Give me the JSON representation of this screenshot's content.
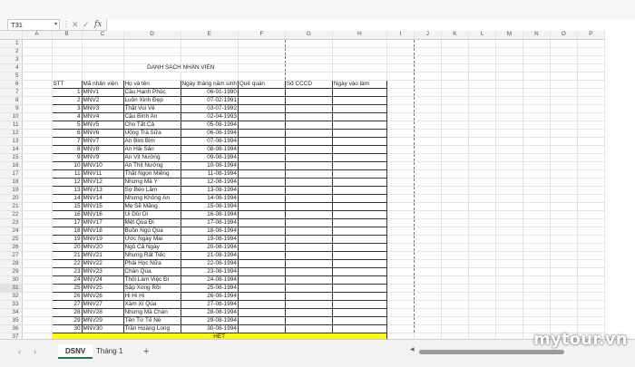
{
  "formula_bar": {
    "name_box": "T31",
    "icons": [
      "more-options-icon",
      "cancel-icon",
      "enter-icon",
      "function-icon"
    ],
    "fx_label": "fx",
    "formula": ""
  },
  "columns": [
    "A",
    "B",
    "C",
    "D",
    "E",
    "F",
    "G",
    "H",
    "I",
    "J",
    "K",
    "L",
    "M",
    "N",
    "O",
    "P"
  ],
  "selected_row": 31,
  "sheet": {
    "title": "DANH SÁCH NHÂN VIÊN",
    "headers": [
      "STT",
      "Mã nhân viên",
      "Họ và tên",
      "Ngày tháng năm sinh",
      "Quê quán",
      "Số CCCD",
      "Ngày vào làm"
    ],
    "rows": [
      [
        "1",
        "MNV1",
        "Cầu Hạnh Phúc",
        "06-01-1990"
      ],
      [
        "2",
        "MNV2",
        "Luôn Xinh Đẹp",
        "07-02-1991"
      ],
      [
        "3",
        "MNV3",
        "Thật Vui Vẻ",
        "03-07-1992"
      ],
      [
        "4",
        "MNV4",
        "Cầu Bình An",
        "02-04-1993"
      ],
      [
        "5",
        "MNV5",
        "Cho Tất Cả",
        "05-08-1994"
      ],
      [
        "6",
        "MNV6",
        "Uống Trà Sữa",
        "06-08-1994"
      ],
      [
        "7",
        "MNV7",
        "Ăn Bim Bim",
        "07-08-1994"
      ],
      [
        "8",
        "MNV8",
        "Ăn Hải Sản",
        "08-08-1994"
      ],
      [
        "9",
        "MNV9",
        "Ăn Vịt Nướng",
        "09-08-1994"
      ],
      [
        "10",
        "MNV10",
        "Ăn Thịt Nướng",
        "10-08-1994"
      ],
      [
        "11",
        "MNV11",
        "Thật Ngon Miệng",
        "11-08-1994"
      ],
      [
        "12",
        "MNV12",
        "Nhưng Mà Ý",
        "12-08-1994"
      ],
      [
        "13",
        "MNV13",
        "Sợ Béo Lắm",
        "13-08-1994"
      ],
      [
        "14",
        "MNV14",
        "Nhưng Không Ăn",
        "14-08-1994"
      ],
      [
        "15",
        "MNV15",
        "Mẹ Sẽ Mắng",
        "15-08-1994"
      ],
      [
        "16",
        "MNV16",
        "Ui Dồi Ôi",
        "16-08-1994"
      ],
      [
        "17",
        "MNV17",
        "Mệt Qúa Đi",
        "17-08-1994"
      ],
      [
        "18",
        "MNV18",
        "Buồn Ngủ Qúa",
        "18-08-1994"
      ],
      [
        "19",
        "MNV19",
        "Ước Ngày Mai",
        "19-08-1994"
      ],
      [
        "20",
        "MNV20",
        "Ngủ Cả Ngày",
        "20-08-1994"
      ],
      [
        "21",
        "MNV21",
        "Nhưng Rất Tiếc",
        "21-08-1994"
      ],
      [
        "22",
        "MNV22",
        "Phải Học Nữa",
        "22-08-1994"
      ],
      [
        "23",
        "MNV23",
        "Chán Qúa",
        "23-08-1994"
      ],
      [
        "24",
        "MNV24",
        "Thôi Làm Việc Đi",
        "24-08-1994"
      ],
      [
        "25",
        "MNV25",
        "Sắp Xong Rồi",
        "25-08-1994"
      ],
      [
        "26",
        "MNV26",
        "Hi Hi Hi",
        "26-08-1994"
      ],
      [
        "27",
        "MNV27",
        "Xàm Xí Qúa",
        "27-08-1994"
      ],
      [
        "28",
        "MNV28",
        "Nhưng Mà Chán",
        "28-08-1994"
      ],
      [
        "29",
        "MNV29",
        "Tên Từ Tế Nè",
        "29-08-1994"
      ],
      [
        "30",
        "MNV30",
        "Trần Hoàng Long",
        "30-08-1994"
      ]
    ],
    "total_label": "HẾT"
  },
  "tabs": {
    "prev_icon": "‹",
    "next_icon": "›",
    "items": [
      "DSNV",
      "Tháng 1"
    ],
    "active": "DSNV",
    "add_icon": "+"
  },
  "watermark": "mytour.vn",
  "colors": {
    "highlight": "#ffff00",
    "active_tab_accent": "#1e7b45",
    "header_bg": "#f3f3f3"
  }
}
